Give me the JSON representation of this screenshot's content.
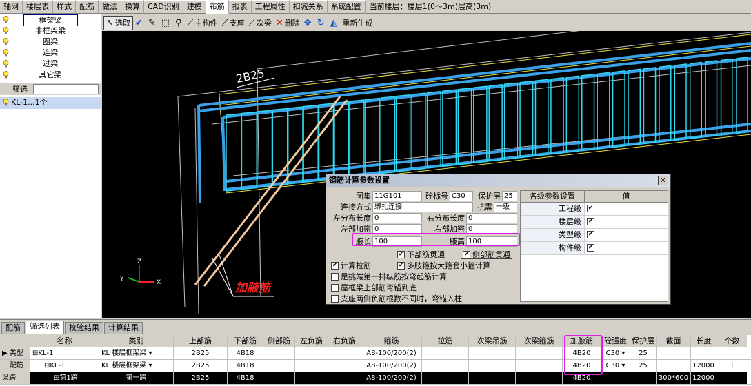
{
  "menu": {
    "tabs": [
      "轴网",
      "楼层表",
      "样式",
      "配筋",
      "做法",
      "换算",
      "CAD识别",
      "建模",
      "布筋",
      "报表",
      "工程属性",
      "扣减关系",
      "系统配置"
    ],
    "active_index": 8,
    "floor_info": "当前楼层：楼层1(0～3m)层高(3m)"
  },
  "left_panel": {
    "categories": [
      "框架梁",
      "非框架梁",
      "圈梁",
      "连梁",
      "过梁",
      "其它梁"
    ],
    "filter_label": "筛选",
    "list_item": "KL-1...1个"
  },
  "toolbar": {
    "select": "选取",
    "main_member": "主构件",
    "support": "支座",
    "secondary_beam": "次梁",
    "delete": "删除",
    "regenerate": "重新生成"
  },
  "viewport": {
    "rebar_label": "2B25",
    "haunch_annotation": "加腋筋",
    "axes": {
      "x": "X",
      "y": "Y",
      "z": "Z"
    },
    "colors": {
      "stirrup": "#30d8f0",
      "main_bar": "#3aa0e8",
      "haunch_bar": "#f0c8a0",
      "frame": "#e8e040"
    }
  },
  "dialog": {
    "title": "钢筋计算参数设置",
    "close": "✕",
    "fields": {
      "atlas_label": "图集",
      "atlas_value": "11G101",
      "concrete_label": "砼标号",
      "concrete_value": "C30",
      "cover_label": "保护层",
      "cover_value": "25",
      "connection_label": "连接方式",
      "connection_value": "绑扎连接",
      "seismic_label": "抗震",
      "seismic_value": "一级",
      "left_dist_label": "左分布长度",
      "left_dist_value": "0",
      "right_dist_label": "右分布长度",
      "right_dist_value": "0",
      "left_dense_label": "左部加密",
      "left_dense_value": "0",
      "right_dense_label": "右部加密",
      "right_dense_value": "0",
      "haunch_len_label": "腋长",
      "haunch_len_value": "100",
      "haunch_h_label": "腋高",
      "haunch_h_value": "100"
    },
    "checks": [
      {
        "label": "下部筋贯通",
        "checked": true
      },
      {
        "label": "侧部筋贯通",
        "checked": true
      },
      {
        "label": "计算拉筋",
        "checked": true
      },
      {
        "label": "多肢箍按大箍套小箍计算",
        "checked": true
      },
      {
        "label": "是挑端第一排纵筋按弯起筋计算",
        "checked": false
      },
      {
        "label": "屋框梁上部筋弯锚到底",
        "checked": false
      },
      {
        "label": "支座两侧负筋根数不同时，弯锚入柱",
        "checked": false
      }
    ],
    "levels": {
      "header_name": "各级参数设置",
      "header_value": "值",
      "rows": [
        "工程级",
        "楼层级",
        "类型级",
        "构件级"
      ]
    }
  },
  "bottom_tabs": [
    "配筋",
    "筛选列表",
    "校验结果",
    "计算结果"
  ],
  "bottom_active": 1,
  "grid": {
    "columns": [
      "名称",
      "类别",
      "上部筋",
      "下部筋",
      "侧部筋",
      "左负筋",
      "右负筋",
      "箍筋",
      "拉筋",
      "次梁吊筋",
      "次梁箍筋",
      "加腋筋",
      "砼强度",
      "保护层",
      "截面",
      "长度",
      "个数"
    ],
    "rows": [
      {
        "hdr": "类型",
        "name": "⊟KL-1",
        "cat": "KL   楼层框架梁",
        "top": "2B25",
        "bottom": "4B18",
        "side": "",
        "lneg": "",
        "rneg": "",
        "stirrup": "A8-100/200(2)",
        "tie": "",
        "hang": "",
        "sstir": "",
        "haunch": "4B20",
        "conc": "C30",
        "cover": "25",
        "section": "",
        "length": "",
        "count": ""
      },
      {
        "hdr": "配筋",
        "name": "⊟KL-1",
        "cat": "KL   楼层框架梁",
        "top": "2B25",
        "bottom": "4B18",
        "side": "",
        "lneg": "",
        "rneg": "",
        "stirrup": "A8-100/200(2)",
        "tie": "",
        "hang": "",
        "sstir": "",
        "haunch": "4B20",
        "conc": "C30",
        "cover": "25",
        "section": "",
        "length": "12000",
        "count": "1"
      },
      {
        "hdr": "梁跨",
        "name": "⊞第1跨",
        "cat": "第一跨",
        "top": "2B25",
        "bottom": "4B18",
        "side": "",
        "lneg": "",
        "rneg": "",
        "stirrup": "A8-100/200(2)",
        "tie": "",
        "hang": "",
        "sstir": "",
        "haunch": "4B20",
        "conc": "",
        "cover": "",
        "section": "300*600",
        "length": "12000",
        "count": ""
      }
    ]
  }
}
